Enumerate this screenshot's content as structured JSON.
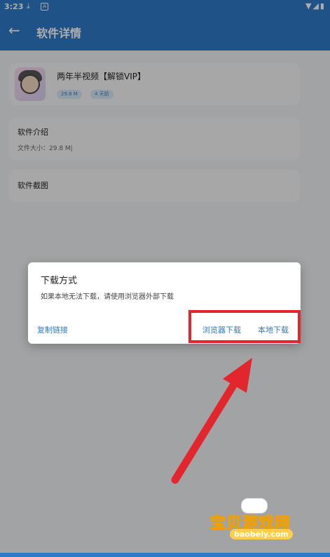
{
  "statusbar": {
    "time": "3:23",
    "download_icon": "download-icon",
    "a_icon": "a-icon",
    "right_icons": "▼◢▮"
  },
  "appbar": {
    "title": "软件详情",
    "back": "←"
  },
  "app": {
    "name": "两年半视频【解锁VIP】",
    "size_tag": "29.8 M",
    "age_tag": "4 天前"
  },
  "intro": {
    "heading": "软件介绍",
    "file_size": "文件大小：29.8 M|"
  },
  "screenshots": {
    "heading": "软件截图"
  },
  "dialog": {
    "title": "下载方式",
    "message": "如果本地无法下载，请使用浏览器外部下载",
    "copy_link": "复制链接",
    "browser_download": "浏览器下载",
    "local_download": "本地下载"
  },
  "watermark": {
    "cn": "宝贝游戏网",
    "en": "baobeiy.com"
  },
  "colors": {
    "primary": "#2f79c6",
    "highlight_red": "#e3262d"
  }
}
